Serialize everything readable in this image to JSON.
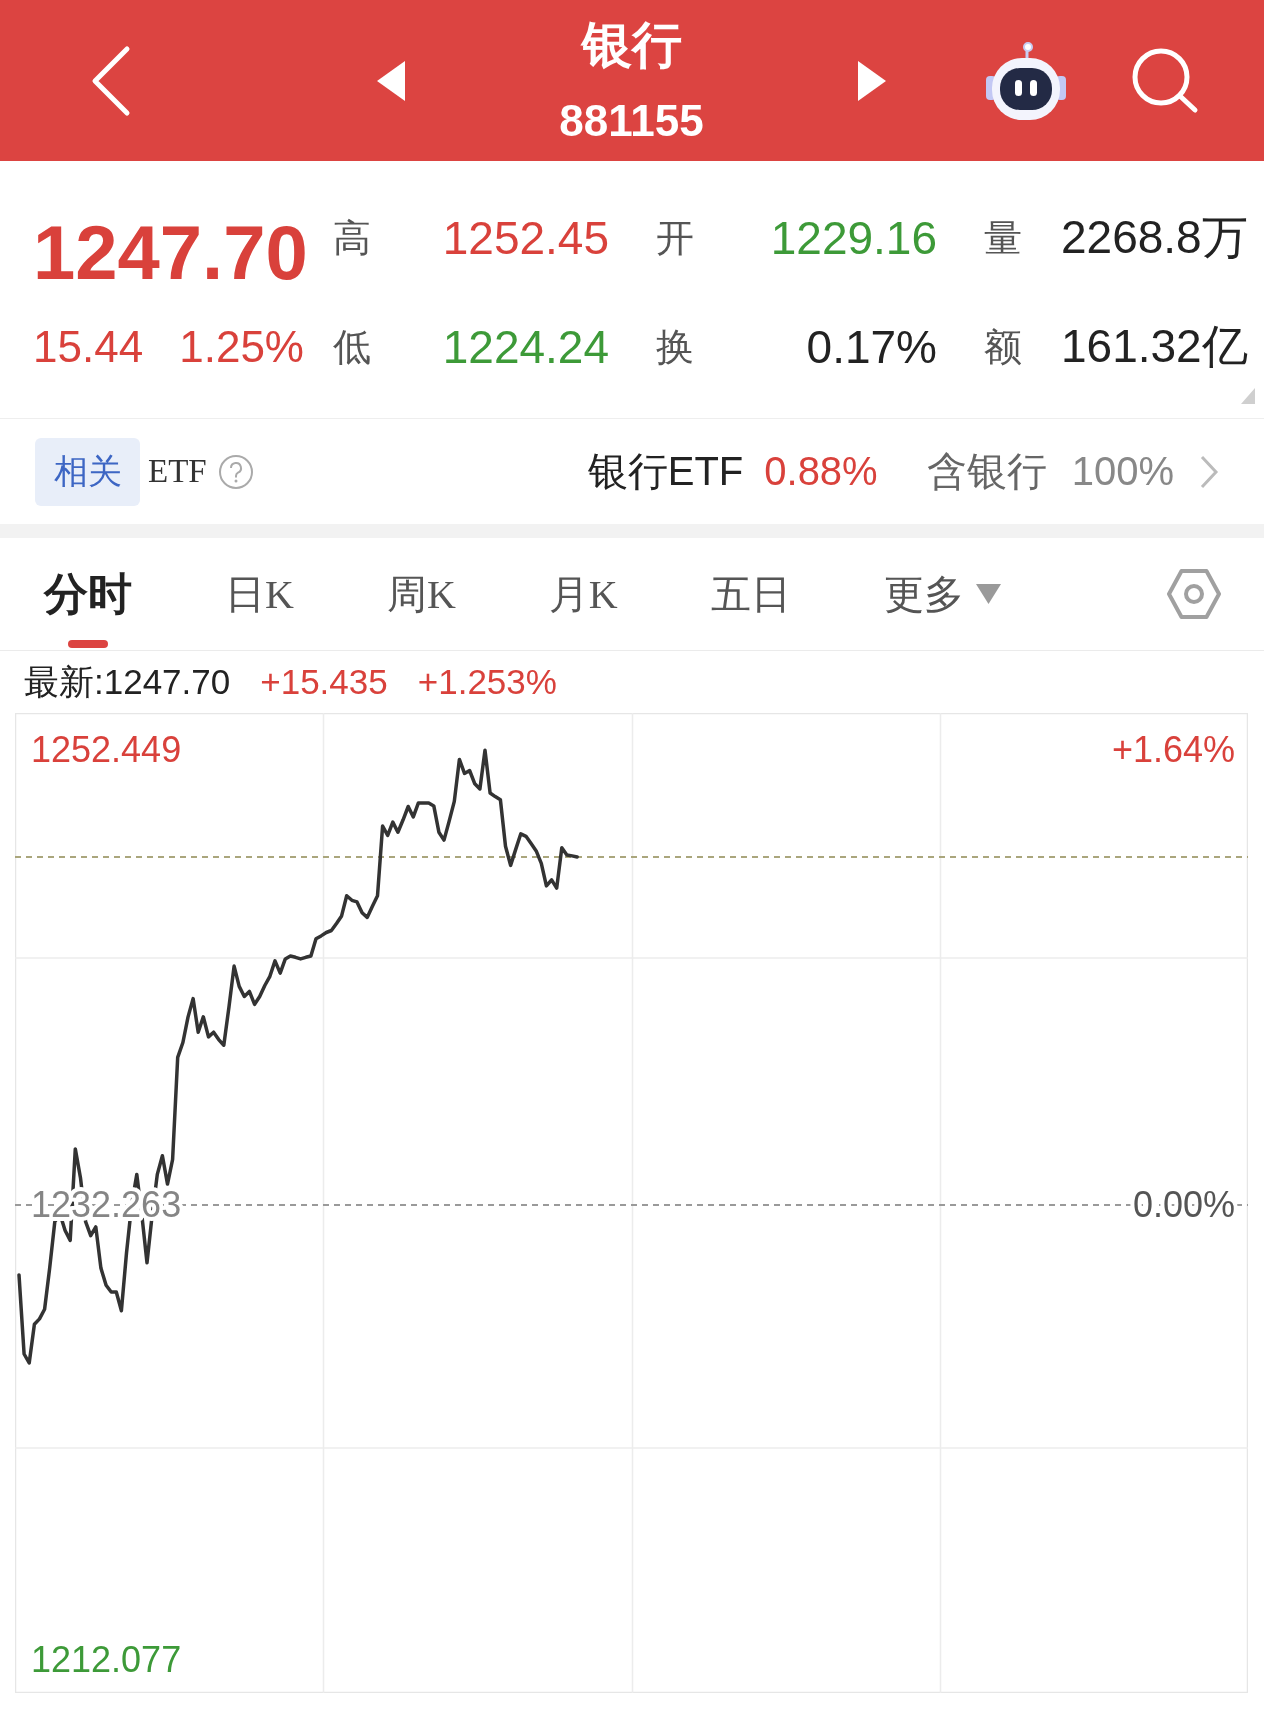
{
  "header": {
    "title": "银行",
    "code": "881155"
  },
  "quote": {
    "price": {
      "text": "1247.70",
      "color": "#d9413b"
    },
    "change": [
      {
        "text": "15.44",
        "color": "#d9413b"
      },
      {
        "text": "1.25%",
        "color": "#d9413b"
      }
    ],
    "stats": [
      {
        "label": "高",
        "value": "1252.45",
        "color": "#d9413b"
      },
      {
        "label": "开",
        "value": "1229.16",
        "color": "#3d9a38"
      },
      {
        "label": "量",
        "value": "2268.8万",
        "color": "#222222"
      },
      {
        "label": "低",
        "value": "1224.24",
        "color": "#3d9a38"
      },
      {
        "label": "换",
        "value": "0.17%",
        "color": "#222222"
      },
      {
        "label": "额",
        "value": "161.32亿",
        "color": "#222222"
      }
    ]
  },
  "etf": {
    "tag": "相关",
    "label": "ETF",
    "name": "银行ETF",
    "change": {
      "text": "0.88%",
      "color": "#d9413b"
    },
    "holding_label": "含银行",
    "holding_value": "100%"
  },
  "tabs": [
    {
      "label": "分时",
      "selected": true,
      "dropdown": false
    },
    {
      "label": "日K",
      "selected": false,
      "dropdown": false
    },
    {
      "label": "周K",
      "selected": false,
      "dropdown": false
    },
    {
      "label": "月K",
      "selected": false,
      "dropdown": false
    },
    {
      "label": "五日",
      "selected": false,
      "dropdown": false
    },
    {
      "label": "更多",
      "selected": false,
      "dropdown": true
    }
  ],
  "legend": [
    {
      "text": "最新:1247.70",
      "color": "#222222"
    },
    {
      "text": "+15.435",
      "color": "#d9413b"
    },
    {
      "text": "+1.253%",
      "color": "#d9413b"
    }
  ],
  "chart": {
    "chart_data": {
      "type": "line",
      "categories": [
        null,
        null,
        null,
        null,
        null,
        null,
        null,
        null,
        null,
        null,
        null,
        null,
        null,
        null,
        null,
        null,
        null,
        null,
        null,
        null,
        null,
        null,
        null,
        null,
        null,
        null,
        null,
        null,
        null,
        null,
        null,
        null,
        null,
        null,
        null,
        null,
        null,
        null,
        null,
        null,
        null,
        null,
        null,
        null,
        null,
        null,
        null,
        null,
        null,
        null,
        null,
        null,
        null,
        null,
        null,
        null,
        null,
        null,
        null,
        null,
        null,
        null,
        null,
        null,
        null,
        null,
        null,
        null,
        null,
        null,
        null,
        null,
        null,
        null,
        null,
        null,
        null,
        null,
        null,
        null,
        null,
        null,
        null,
        null,
        null,
        null,
        null,
        null,
        null,
        null,
        null,
        null,
        null,
        null,
        null,
        null,
        null,
        null,
        null,
        null,
        null,
        null,
        null,
        null,
        null,
        null,
        null,
        null,
        null,
        null,
        null,
        null,
        null,
        null,
        null,
        null,
        null,
        null,
        null,
        null,
        null,
        null,
        null,
        null,
        null,
        null,
        null,
        null,
        null,
        null,
        null,
        null,
        null,
        null,
        null,
        null,
        null,
        null,
        null,
        null,
        null,
        null,
        null,
        null,
        null,
        null,
        null,
        null,
        null,
        null,
        null,
        null,
        null,
        null,
        null,
        null,
        null,
        null,
        null,
        null,
        null,
        null,
        null,
        null,
        null,
        null,
        null,
        null,
        null,
        null,
        null,
        null,
        null,
        null,
        null,
        null,
        null,
        null,
        null,
        null,
        null,
        null,
        null,
        null,
        null,
        null,
        null,
        null,
        null,
        null,
        null,
        null,
        null,
        null,
        null,
        null,
        null,
        null,
        null,
        null,
        null,
        null,
        null,
        null,
        null,
        null,
        null,
        null,
        null,
        null,
        null,
        null,
        null,
        null,
        null,
        null,
        null,
        null,
        null,
        null,
        null,
        null,
        null,
        null,
        null,
        null,
        null,
        null,
        null,
        null,
        null,
        null,
        null,
        null,
        null,
        null,
        null,
        null,
        null,
        null,
        null
      ],
      "values": [
        1229.16,
        1225.65,
        1225.25,
        1226.97,
        1227.21,
        1227.64,
        1229.47,
        1231.52,
        1231.86,
        1231.13,
        1230.69,
        1234.75,
        1233.46,
        1231.52,
        1230.9,
        1231.29,
        1229.46,
        1228.7,
        1228.4,
        1228.4,
        1227.57,
        1230.13,
        1232.29,
        1233.62,
        1231.79,
        1229.7,
        1231.79,
        1233.62,
        1234.45,
        1233.19,
        1234.28,
        1238.81,
        1239.47,
        1240.6,
        1241.42,
        1239.93,
        1240.61,
        1239.72,
        1239.93,
        1239.6,
        1239.35,
        1241.06,
        1242.86,
        1241.96,
        1241.51,
        1241.74,
        1241.16,
        1241.51,
        1242.0,
        1242.41,
        1243.09,
        1242.55,
        1243.18,
        1243.31,
        1243.25,
        1243.18,
        1243.25,
        1243.31,
        1244.07,
        1244.2,
        1244.35,
        1244.44,
        1244.75,
        1245.09,
        1245.98,
        1245.78,
        1245.71,
        1245.23,
        1245.02,
        1245.5,
        1245.98,
        1249.07,
        1248.66,
        1249.25,
        1248.8,
        1249.35,
        1249.94,
        1249.48,
        1250.1,
        1250.1,
        1250.1,
        1249.97,
        1248.8,
        1248.45,
        1249.28,
        1250.17,
        1252.03,
        1251.41,
        1251.54,
        1250.95,
        1250.72,
        1252.44,
        1250.54,
        1250.38,
        1250.24,
        1248.18,
        1247.33,
        1248.04,
        1248.73,
        1248.62,
        1248.3,
        1247.97,
        1247.42,
        1246.42,
        1246.69,
        1246.32,
        1248.11,
        1247.79,
        1247.75,
        1247.7,
        null,
        null,
        null,
        null,
        null,
        null,
        null,
        null,
        null,
        null,
        null,
        null,
        null,
        null,
        null,
        null,
        null,
        null,
        null,
        null,
        null,
        null,
        null,
        null,
        null,
        null,
        null,
        null,
        null,
        null,
        null,
        null,
        null,
        null,
        null,
        null,
        null,
        null,
        null,
        null,
        null,
        null,
        null,
        null,
        null,
        null,
        null,
        null,
        null,
        null,
        null,
        null,
        null,
        null,
        null,
        null,
        null,
        null,
        null,
        null,
        null,
        null,
        null,
        null,
        null,
        null,
        null,
        null,
        null,
        null,
        null,
        null,
        null,
        null,
        null,
        null,
        null,
        null,
        null,
        null,
        null,
        null,
        null,
        null,
        null,
        null,
        null,
        null,
        null,
        null,
        null,
        null,
        null,
        null,
        null,
        null,
        null,
        null,
        null,
        null,
        null,
        null,
        null,
        null,
        null,
        null,
        null,
        null,
        null,
        null,
        null,
        null,
        null,
        null,
        null,
        null,
        null,
        null,
        null,
        null,
        null,
        null,
        null,
        null,
        null,
        null,
        null,
        null,
        null,
        null,
        null
      ],
      "ylim": [
        1210.61,
        1254.09
      ],
      "yticks": [
        {
          "value": 1252.449,
          "label": "1252.449"
        },
        {
          "value": 1232.263,
          "label": "1232.263"
        },
        {
          "value": 1212.077,
          "label": "1212.077"
        }
      ],
      "ref_lines": [
        {
          "axis": "y",
          "value": 1232.263,
          "color": "#9a9a9a"
        },
        {
          "axis": "y",
          "value": 1247.7,
          "color": "#aaa67c"
        }
      ]
    },
    "right_labels": [
      "+1.64%",
      "0.00%"
    ]
  }
}
